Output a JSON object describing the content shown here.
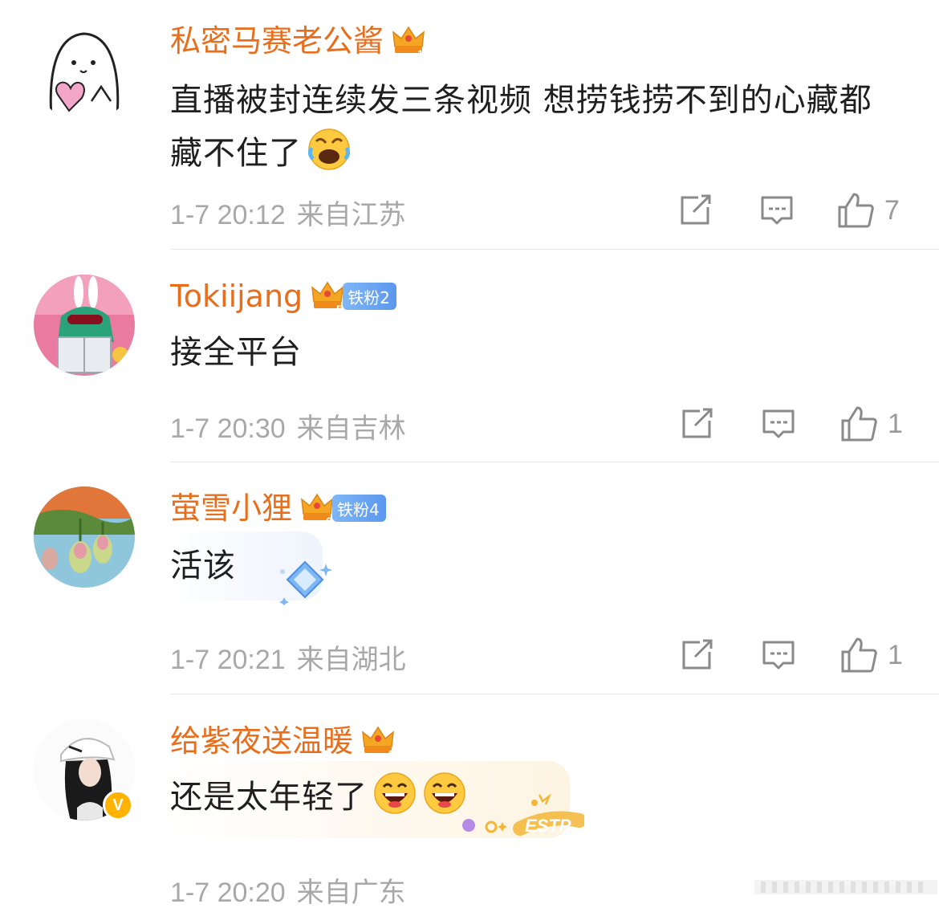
{
  "comments": [
    {
      "username": "私密马赛老公酱",
      "text": "直播被封连续发三条视频 想捞钱捞不到的心藏都藏不住了",
      "emoji": "laughing-crying-emoji",
      "time": "1-7 20:12",
      "location": "来自江苏",
      "likes": "7",
      "crown_level": "1"
    },
    {
      "username": "Tokiijang",
      "fan_badge": "铁粉2",
      "text": "接全平台",
      "time": "1-7 20:30",
      "location": "来自吉林",
      "likes": "1",
      "crown_level": "5"
    },
    {
      "username": "萤雪小狸",
      "fan_badge": "铁粉4",
      "text": "活该",
      "time": "1-7 20:21",
      "location": "来自湖北",
      "likes": "1",
      "crown_level": "6"
    },
    {
      "username": "给紫夜送温暖",
      "text": "还是太年轻了",
      "emoji": "grinning-emoji",
      "time": "1-7 20:20",
      "location": "来自广东",
      "crown_level": "4",
      "verified_badge": "V",
      "bubble_tag": "ESTP"
    }
  ],
  "icons": {
    "share": "share-icon",
    "reply": "comment-icon",
    "like": "thumbs-up-icon"
  },
  "colors": {
    "username": "#e86e1c",
    "meta": "#a8a8a8",
    "fan_badge": "#5b97ee",
    "crown": "#f5a623"
  }
}
